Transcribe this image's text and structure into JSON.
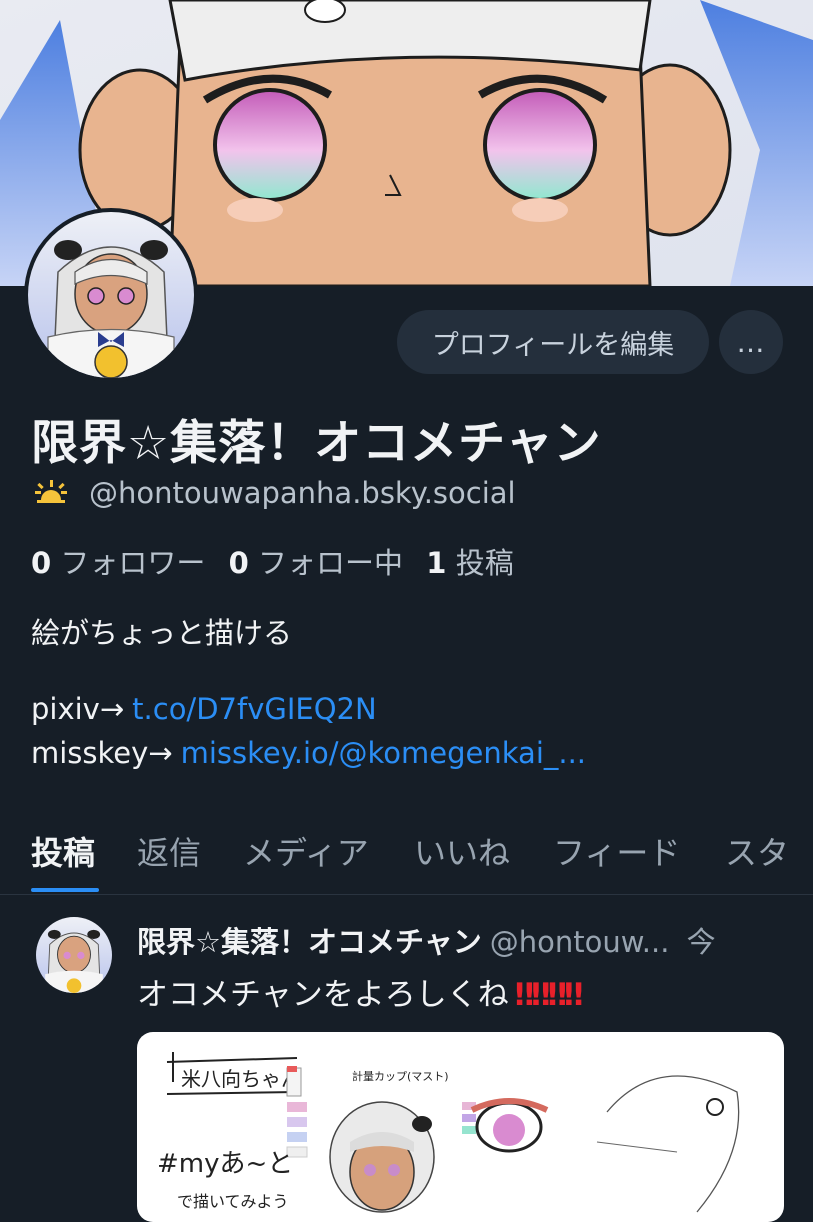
{
  "profile": {
    "edit_button": "プロフィールを編集",
    "more_button": "…",
    "display_name": "限界☆集落！オコメチャン",
    "handle": "@hontouwapanha.bsky.social",
    "stats": {
      "followers_count": "0",
      "followers_label": "フォロワー",
      "following_count": "0",
      "following_label": "フォロー中",
      "posts_count": "1",
      "posts_label": "投稿"
    },
    "bio": {
      "line1": "絵がちょっと描ける",
      "pixiv_label": "pixiv→",
      "pixiv_link": "t.co/D7fvGIEQ2N",
      "misskey_label": "misskey→",
      "misskey_link": "misskey.io/@komegenkai_..."
    }
  },
  "tabs": [
    {
      "label": "投稿",
      "active": true
    },
    {
      "label": "返信"
    },
    {
      "label": "メディア"
    },
    {
      "label": "いいね"
    },
    {
      "label": "フィード"
    },
    {
      "label": "スタ"
    }
  ],
  "post": {
    "name": "限界☆集落！オコメチャン",
    "handle": "@hontouw...",
    "time": "今",
    "text": "オコメチャンをよろしくね",
    "emoji": "‼‼‼‼",
    "image_text": {
      "title": "米八向ちゃん",
      "cup_note": "計量カップ(マスト)",
      "hashtag": "#myあ~と",
      "hashtag_note": "で描いてみよう"
    }
  },
  "colors": {
    "background": "#161e27",
    "accent": "#2b8ef5",
    "muted_text": "#98a4b0",
    "button_bg": "#242f3c"
  },
  "icons": [
    "sunrise-icon",
    "more-icon"
  ]
}
